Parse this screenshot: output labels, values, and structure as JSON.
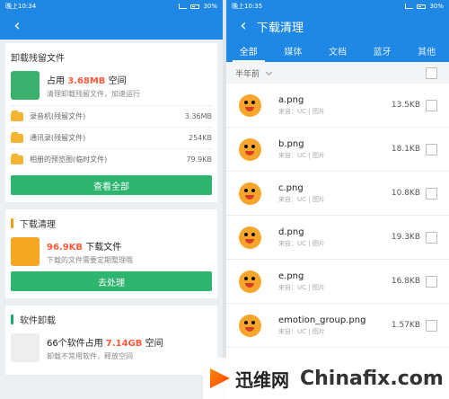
{
  "left_panel": {
    "status": {
      "left": "晚上10:34",
      "right": "30%"
    },
    "header": {
      "back": "‹"
    },
    "card1": {
      "title": "卸载残留文件",
      "hero_prefix": "占用",
      "hero_size": "3.68MB",
      "hero_suffix": "空间",
      "desc": "清理卸载残留文件，加速运行",
      "rows": [
        {
          "label": "录音机(残留文件)",
          "size": "3.36MB"
        },
        {
          "label": "通讯录(残留文件)",
          "size": "254KB"
        },
        {
          "label": "相册的预览图(临时文件)",
          "size": "79.9KB"
        }
      ],
      "button": "查看全部"
    },
    "card2": {
      "title": "下载清理",
      "hero_size": "96.9KB",
      "hero_suffix": "下载文件",
      "desc": "下载的文件需要定期整理哦",
      "button": "去处理"
    },
    "card3": {
      "title": "软件卸载",
      "hero_prefix": "66个软件占用",
      "hero_size": "7.14GB",
      "hero_suffix": "空间",
      "desc": "卸载不常用软件，释放空间"
    }
  },
  "right_panel": {
    "status": {
      "left": "晚上10:35",
      "right": "30%"
    },
    "header": {
      "back": "‹",
      "title": "下载清理"
    },
    "tabs": [
      "全部",
      "媒体",
      "文档",
      "蓝牙",
      "其他"
    ],
    "group": {
      "label": "半年前"
    },
    "files": [
      {
        "name": "a.png",
        "source": "来自：UC | 图片",
        "size": "13.5KB"
      },
      {
        "name": "b.png",
        "source": "来自：UC | 图片",
        "size": "18.1KB"
      },
      {
        "name": "c.png",
        "source": "来自：UC | 图片",
        "size": "10.8KB"
      },
      {
        "name": "d.png",
        "source": "来自：UC | 图片",
        "size": "19.3KB"
      },
      {
        "name": "e.png",
        "source": "来自：UC | 图片",
        "size": "16.8KB"
      },
      {
        "name": "emotion_group.png",
        "source": "来自：UC | 图片",
        "size": "1.57KB"
      }
    ]
  },
  "watermark": {
    "cn": "迅维网",
    "en": "Chinafix.com"
  },
  "colors": {
    "primary": "#1f88e5",
    "green": "#2db56f",
    "highlight": "#ff5a3c",
    "orange": "#f39c12"
  }
}
